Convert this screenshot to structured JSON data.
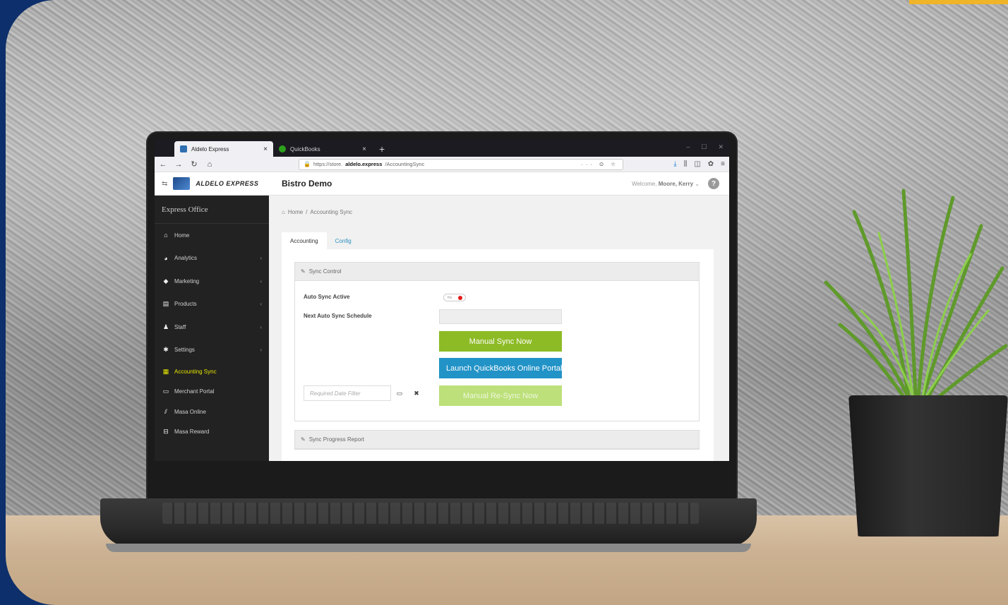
{
  "browser": {
    "tabs": [
      {
        "label": "Aldelo Express",
        "active": true
      },
      {
        "label": "QuickBooks",
        "active": false
      }
    ],
    "new_tab": "+",
    "url_prefix": "https://store.",
    "url_domain": "aldelo.express",
    "url_path": "/AccountingSync",
    "url_actions": "··· ⊙ ☆"
  },
  "app": {
    "brand": "ALDELO EXPRESS",
    "title": "Bistro Demo",
    "welcome_prefix": "Welcome, ",
    "welcome_user": "Moore, Kerry",
    "help": "?"
  },
  "sidebar": {
    "title": "Express Office",
    "items": [
      {
        "label": "Home",
        "icon": "home-icon",
        "chevron": ""
      },
      {
        "label": "Analytics",
        "icon": "pie-chart-icon",
        "chevron": "‹"
      },
      {
        "label": "Marketing",
        "icon": "tag-icon",
        "chevron": "‹"
      },
      {
        "label": "Products",
        "icon": "document-icon",
        "chevron": "‹"
      },
      {
        "label": "Staff",
        "icon": "user-icon",
        "chevron": "‹"
      },
      {
        "label": "Settings",
        "icon": "gear-icon",
        "chevron": "‹"
      },
      {
        "label": "Accounting Sync",
        "icon": "accounting-icon",
        "chevron": ""
      },
      {
        "label": "Merchant Portal",
        "icon": "card-icon",
        "chevron": ""
      },
      {
        "label": "Masa Online",
        "icon": "masa-icon",
        "chevron": ""
      },
      {
        "label": "Masa Reward",
        "icon": "reward-icon",
        "chevron": ""
      }
    ],
    "active_color": "#e6e600"
  },
  "breadcrumb": {
    "home": "Home",
    "separator": "/",
    "current": "Accounting Sync"
  },
  "tabs": [
    {
      "label": "Accounting",
      "active": true
    },
    {
      "label": "Config",
      "active": false
    }
  ],
  "sync_control": {
    "header": "Sync Control",
    "auto_sync_label": "Auto Sync Active",
    "auto_sync_value": "No",
    "next_schedule_label": "Next Auto Sync Schedule",
    "next_schedule_value": "",
    "manual_sync_button": "Manual Sync Now",
    "launch_qb_button": "Launch QuickBooks Online Portal",
    "date_filter_placeholder": "Required Date Filter",
    "resync_button": "Manual Re-Sync Now"
  },
  "progress": {
    "header": "Sync Progress Report"
  },
  "colors": {
    "green": "#8dbb25",
    "blue": "#2293c7",
    "light_green": "#bde07a",
    "toggle_off": "#e21b1b"
  }
}
